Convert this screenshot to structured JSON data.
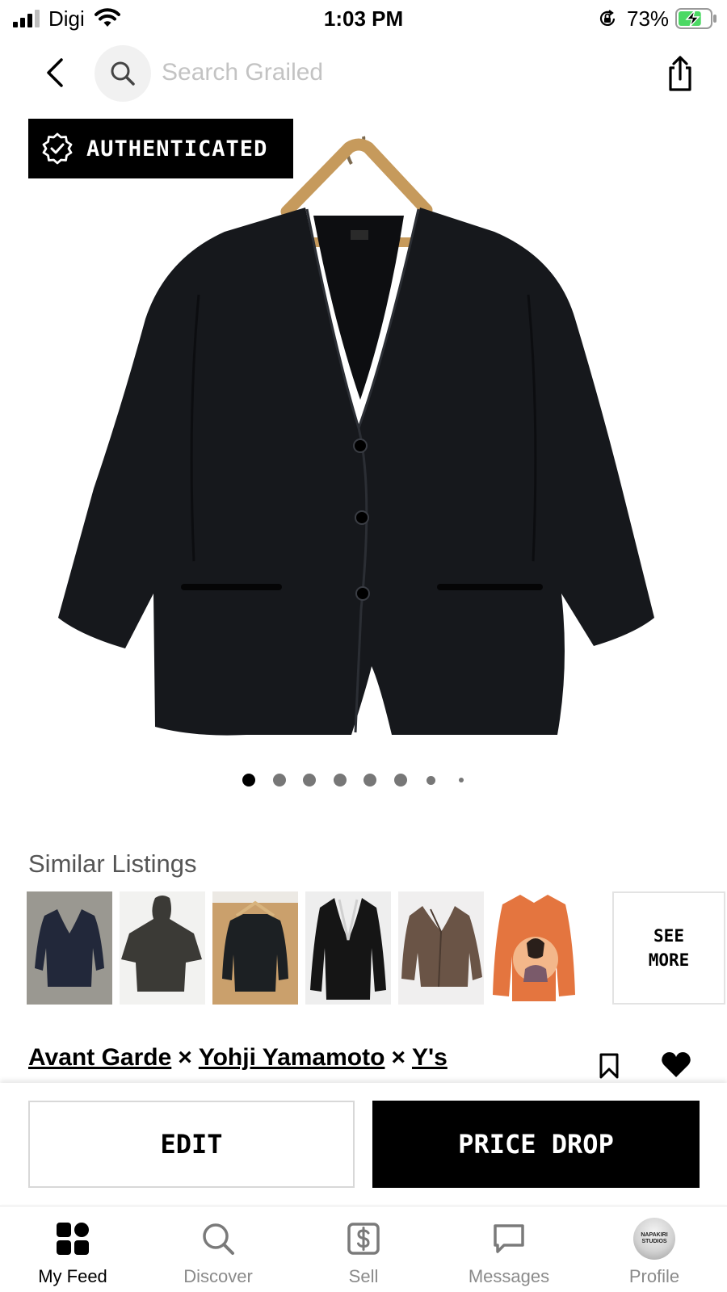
{
  "status_bar": {
    "carrier": "Digi",
    "time": "1:03 PM",
    "battery_percent": "73%",
    "battery_level": 0.73,
    "icons": [
      "cellular-signal-icon",
      "wifi-icon",
      "orientation-lock-icon",
      "battery-charging-icon"
    ]
  },
  "nav": {
    "search_placeholder": "Search Grailed",
    "icons": [
      "back-chevron-icon",
      "search-icon",
      "share-icon"
    ]
  },
  "product": {
    "badge_label": "AUTHENTICATED",
    "image_subject": "black wool collarless cardigan jacket on a wooden hanger",
    "photo_count": 8,
    "active_photo_index": 0
  },
  "similar_listings": {
    "title": "Similar Listings",
    "see_more_line1": "SEE",
    "see_more_line2": "MORE",
    "thumbnails": [
      {
        "subject": "navy blazer",
        "main_color": "#22283a",
        "bg_color": "#9a9891"
      },
      {
        "subject": "black hooded jacket",
        "main_color": "#3b3a36",
        "bg_color": "#f2f2f0"
      },
      {
        "subject": "black jacket on hanger",
        "main_color": "#1c2023",
        "bg_color": "#caa06c"
      },
      {
        "subject": "black blazer",
        "main_color": "#151515",
        "bg_color": "#eeeeee"
      },
      {
        "subject": "brown tweed coat",
        "main_color": "#6a5446",
        "bg_color": "#f0efef"
      },
      {
        "subject": "orange shirt with portrait print",
        "main_color": "#e4753f",
        "bg_color": "#ffffff"
      }
    ]
  },
  "listing": {
    "designers": [
      "Avant Garde",
      "Yohji Yamamoto",
      "Y's"
    ],
    "separator": "×"
  },
  "actions": {
    "edit_label": "EDIT",
    "price_drop_label": "PRICE DROP"
  },
  "tabs": [
    {
      "label": "My Feed",
      "icon": "feed-grid-icon",
      "active": true
    },
    {
      "label": "Discover",
      "icon": "search-icon",
      "active": false
    },
    {
      "label": "Sell",
      "icon": "dollar-tag-icon",
      "active": false
    },
    {
      "label": "Messages",
      "icon": "chat-bubble-icon",
      "active": false
    },
    {
      "label": "Profile",
      "icon": "avatar",
      "active": false
    }
  ],
  "profile_avatar_text_line1": "NAPAKIRI",
  "profile_avatar_text_line2": "STUDIOS"
}
